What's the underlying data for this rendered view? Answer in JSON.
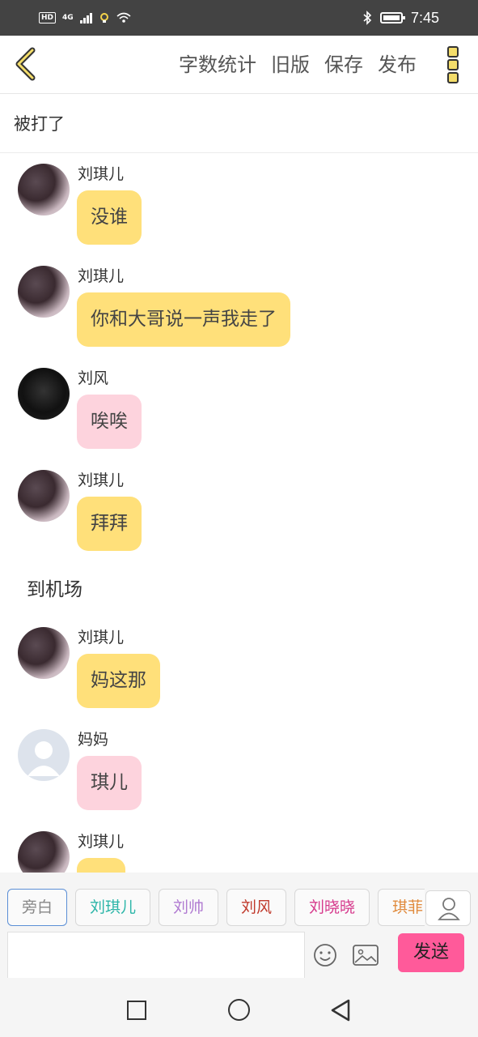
{
  "status_bar": {
    "hd": "HD",
    "network": "4G",
    "time": "7:45"
  },
  "nav": {
    "actions": [
      "字数统计",
      "旧版",
      "保存",
      "发布"
    ]
  },
  "chapter_title": "被打了",
  "messages": [
    {
      "type": "chat",
      "sender": "刘琪儿",
      "text": "没谁",
      "bubble": "yellow",
      "avatar": "qier"
    },
    {
      "type": "chat",
      "sender": "刘琪儿",
      "text": "你和大哥说一声我走了",
      "bubble": "yellow",
      "avatar": "qier"
    },
    {
      "type": "chat",
      "sender": "刘风",
      "text": "唉唉",
      "bubble": "pink",
      "avatar": "feng"
    },
    {
      "type": "chat",
      "sender": "刘琪儿",
      "text": "拜拜",
      "bubble": "yellow",
      "avatar": "qier"
    },
    {
      "type": "narration",
      "text": "到机场"
    },
    {
      "type": "chat",
      "sender": "刘琪儿",
      "text": "妈这那",
      "bubble": "yellow",
      "avatar": "qier"
    },
    {
      "type": "chat",
      "sender": "妈妈",
      "text": "琪儿",
      "bubble": "pink",
      "avatar": "mama"
    },
    {
      "type": "chat",
      "sender": "刘琪儿",
      "text": "",
      "bubble": "yellow",
      "avatar": "qier"
    }
  ],
  "role_chips": [
    {
      "label": "旁白",
      "color": "#888888",
      "active": true
    },
    {
      "label": "刘琪儿",
      "color": "#2bb5a8",
      "active": false
    },
    {
      "label": "刘帅",
      "color": "#b07ad1",
      "active": false
    },
    {
      "label": "刘风",
      "color": "#c0392b",
      "active": false
    },
    {
      "label": "刘晓晓",
      "color": "#d6398c",
      "active": false
    },
    {
      "label": "琪菲",
      "color": "#e08a3c",
      "active": false
    }
  ],
  "input": {
    "value": "",
    "send_label": "发送"
  },
  "icons": {
    "back": "chevron-left-icon",
    "more": "more-vertical-icon",
    "role": "person-icon",
    "emoji": "emoji-icon",
    "image": "image-icon",
    "sys_recents": "square-icon",
    "sys_home": "circle-icon",
    "sys_back": "triangle-back-icon"
  },
  "colors": {
    "accent_yellow": "#ffe07a",
    "accent_pink": "#fdd3dd",
    "send_button": "#ff5a9a"
  }
}
